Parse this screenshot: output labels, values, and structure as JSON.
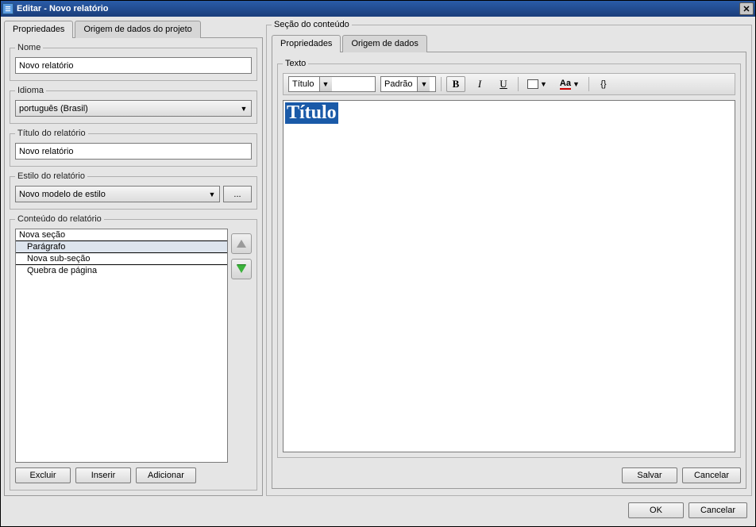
{
  "window": {
    "title": "Editar - Novo relatório"
  },
  "leftTabs": {
    "t0": "Propriedades",
    "t1": "Origem de dados do projeto"
  },
  "groups": {
    "nome": {
      "label": "Nome",
      "value": "Novo relatório"
    },
    "idioma": {
      "label": "Idioma",
      "value": "português (Brasil)"
    },
    "titulo": {
      "label": "Título do relatório",
      "value": "Novo relatório"
    },
    "estilo": {
      "label": "Estilo do relatório",
      "value": "Novo modelo de estilo",
      "more": "..."
    },
    "conteudo": {
      "label": "Conteúdo do relatório",
      "items": {
        "i0": "Nova seção",
        "i1": "Parágrafo",
        "i2": "Nova sub-seção",
        "i3": "Quebra de página"
      }
    }
  },
  "leftButtons": {
    "del": "Excluir",
    "ins": "Inserir",
    "add": "Adicionar"
  },
  "rightSection": {
    "label": "Seção do conteúdo"
  },
  "rightTabs": {
    "t0": "Propriedades",
    "t1": "Origem de dados"
  },
  "textoGroup": {
    "label": "Texto"
  },
  "toolbar": {
    "style": "Título",
    "size": "Padrão",
    "bold": "B",
    "italic": "I",
    "underline": "U",
    "fontcolor": "Aa",
    "braces": "{}"
  },
  "editor": {
    "text": "Título"
  },
  "rightButtons": {
    "save": "Salvar",
    "cancel": "Cancelar"
  },
  "footer": {
    "ok": "OK",
    "cancel": "Cancelar"
  }
}
